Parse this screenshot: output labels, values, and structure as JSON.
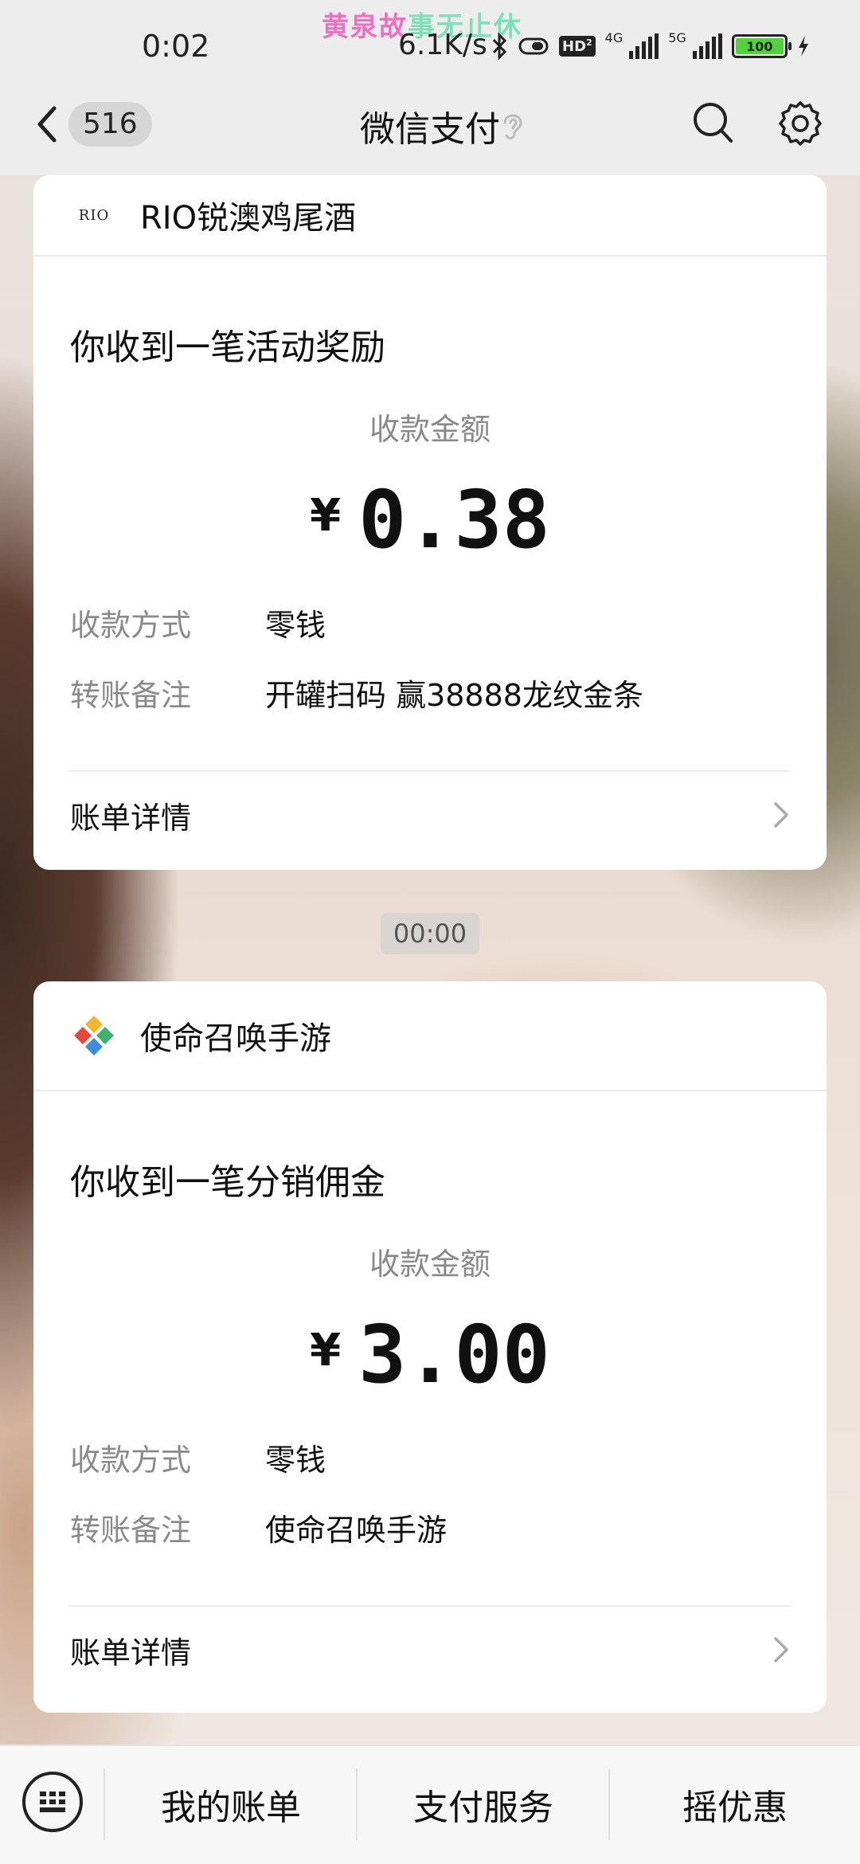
{
  "status_bar": {
    "time": "0:02",
    "overlay_text_pink": "黄泉故",
    "overlay_text_green": "事无止休",
    "net_speed": "6.1K/s",
    "hd_label": "HD",
    "hd_sub": "2",
    "sim1_label": "4G",
    "sim2_label": "5G",
    "battery": "100"
  },
  "nav": {
    "unread_count": "516",
    "title": "微信支付"
  },
  "messages": [
    {
      "merchant_logo_text": "RIO",
      "merchant_name": "RIO锐澳鸡尾酒",
      "title": "你收到一笔活动奖励",
      "amount_label": "收款金额",
      "currency": "¥",
      "amount": "0.38",
      "method_label": "收款方式",
      "method_value": "零钱",
      "note_label": "转账备注",
      "note_value": "开罐扫码 赢38888龙纹金条",
      "detail_label": "账单详情"
    },
    {
      "merchant_name": "使命召唤手游",
      "title": "你收到一笔分销佣金",
      "amount_label": "收款金额",
      "currency": "¥",
      "amount": "3.00",
      "method_label": "收款方式",
      "method_value": "零钱",
      "note_label": "转账备注",
      "note_value": "使命召唤手游",
      "detail_label": "账单详情"
    }
  ],
  "timestamp": "00:00",
  "bottom_menu": {
    "keyboard_icon": "keyboard-icon",
    "items": [
      "我的账单",
      "支付服务",
      "摇优惠"
    ]
  },
  "colors": {
    "background": "#ededed",
    "card": "#ffffff",
    "label_gray": "#8a8a8a",
    "badge_bg": "#d6d6d6",
    "battery_green": "#4fd23c"
  }
}
